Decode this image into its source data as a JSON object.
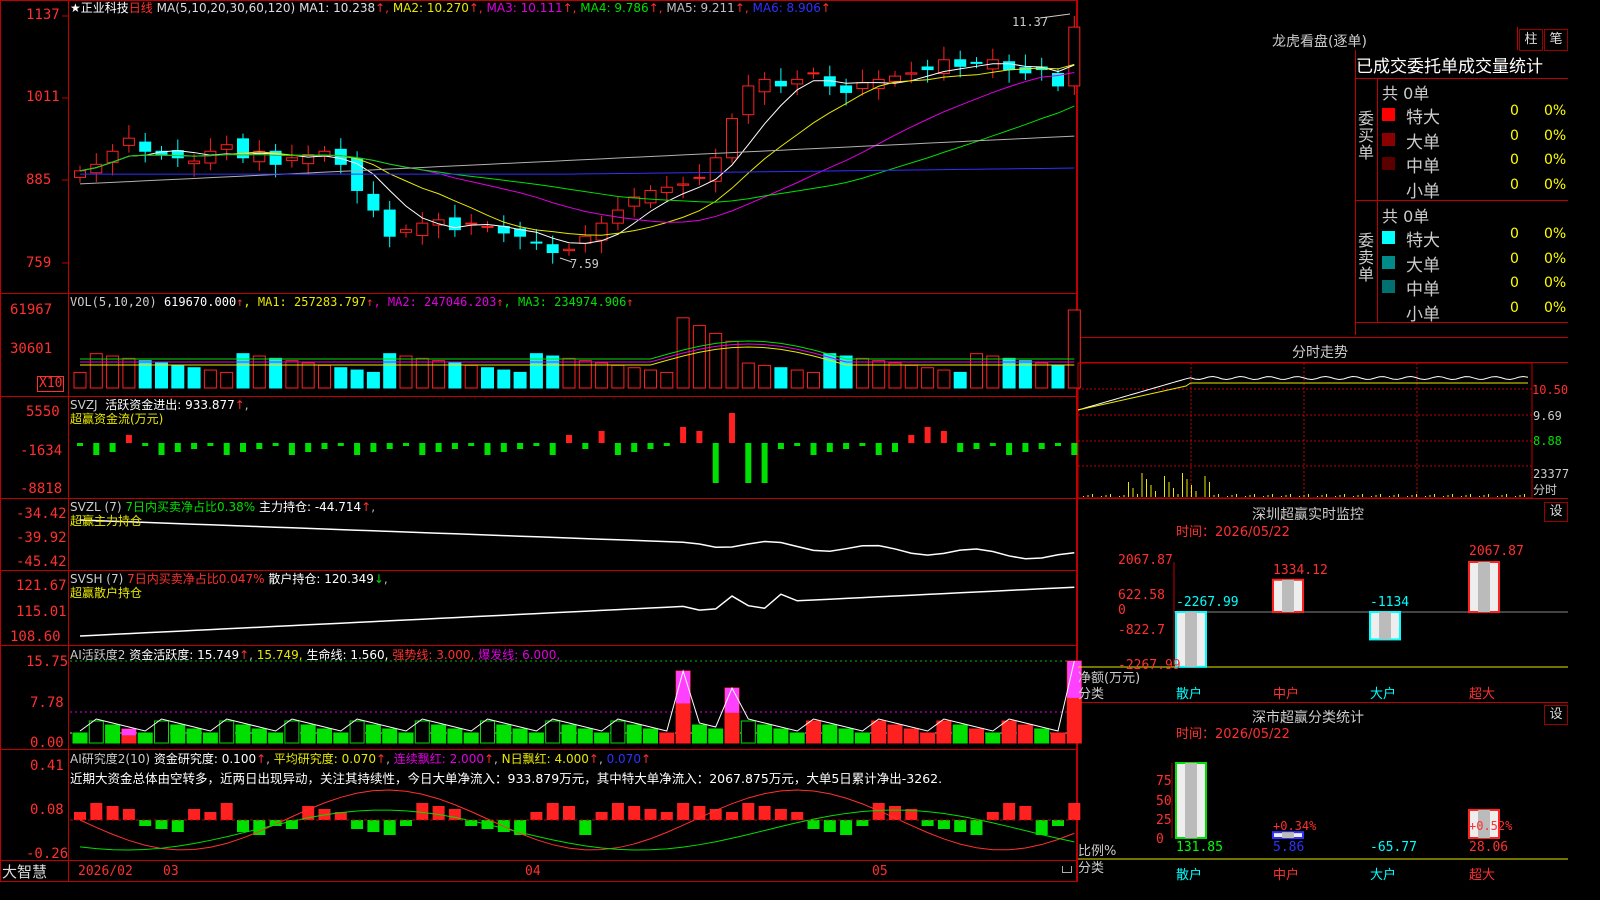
{
  "header": {
    "stock_name": "正业科技",
    "period": "日线",
    "ma_label": "MA(5,10,20,30,60,120)",
    "ma_items": [
      {
        "name": "MA1:",
        "value": "10.238",
        "color": "#e0e0e0"
      },
      {
        "name": "MA2:",
        "value": "10.270",
        "color": "#e8e800"
      },
      {
        "name": "MA3:",
        "value": "10.111",
        "color": "#e000e0"
      },
      {
        "name": "MA4:",
        "value": "9.786",
        "color": "#00e000"
      },
      {
        "name": "MA5:",
        "value": "9.211",
        "color": "#c0c0c0"
      },
      {
        "name": "MA6:",
        "value": "8.906",
        "color": "#3030ff"
      }
    ],
    "arrow": "↑"
  },
  "price_axis": [
    "1137",
    "1011",
    "885",
    "759"
  ],
  "price_marks": {
    "high": "11.37",
    "low": "7.59"
  },
  "vol_panel": {
    "label": "VOL(5,10,20)",
    "value": "619670.000",
    "items": [
      {
        "name": "MA1:",
        "value": "257283.797",
        "color": "#e8e800"
      },
      {
        "name": "MA2:",
        "value": "247046.203",
        "color": "#e000e0"
      },
      {
        "name": "MA3:",
        "value": "234974.906",
        "color": "#00e000"
      }
    ],
    "axis": [
      "61967",
      "30601"
    ],
    "unit": "X10"
  },
  "svzj_panel": {
    "label": "SVZJ",
    "title": "活跃资金进出:",
    "value": "933.877",
    "subtitle": "超赢资金流(万元)",
    "axis": [
      "5550",
      "-1634",
      "-8818"
    ]
  },
  "svzl_panel": {
    "label": "SVZL (7)",
    "ratio": "7日内买卖净占比0.38%",
    "name": "主力持仓:",
    "value": "-44.714",
    "subtitle": "超赢主力持仓",
    "axis": [
      "-34.42",
      "-39.92",
      "-45.42"
    ]
  },
  "svsh_panel": {
    "label": "SVSH (7)",
    "ratio": "7日内买卖净占比0.047%",
    "name": "散户持仓:",
    "value": "120.349",
    "subtitle": "超赢散户持仓",
    "axis": [
      "121.67",
      "115.01",
      "108.60"
    ]
  },
  "ai_active": {
    "label": "AI活跃度2",
    "name": "资金活跃度:",
    "value": "15.749",
    "value2": "15.749,",
    "life": "生命线:",
    "life_v": "1.560,",
    "strong": "强势线:",
    "strong_v": "3.000,",
    "burst": "爆发线:",
    "burst_v": "6.000,",
    "axis": [
      "15.75",
      "7.78",
      "0.00"
    ]
  },
  "ai_research": {
    "label": "AI研究度2(10)",
    "name": "资金研究度:",
    "value": "0.100",
    "avg": "平均研究度:",
    "avg_v": "0.070",
    "cont": "连续飘红:",
    "cont_v": "2.000",
    "nday": "N日飘红:",
    "nday_v": "4.000",
    "last": "0.070",
    "axis": [
      "0.41",
      "0.08",
      "-0.26"
    ],
    "comment": "近期大资金总体由空转多，近两日出现异动，关注其持续性，今日大单净流入：933.879万元，其中特大单净流入：2067.875万元，大单5日累计净出-3262."
  },
  "date_axis": [
    "2026/02",
    "03",
    "04",
    "05"
  ],
  "brand": "大智慧",
  "right": {
    "title": "龙虎看盘(逐单)",
    "btn_bar": "柱",
    "btn_pen": "笔",
    "tabs": [
      "已成交",
      "委托单",
      "成交量统计"
    ],
    "buy_label": "委买单",
    "sell_label": "委卖单",
    "buy_total": "共 0单",
    "sell_total": "共 0单",
    "buy_rows": [
      {
        "name": "特大",
        "n": "0",
        "pct": "0%",
        "color": "#ff0000"
      },
      {
        "name": "大单",
        "n": "0",
        "pct": "0%",
        "color": "#8b0000"
      },
      {
        "name": "中单",
        "n": "0",
        "pct": "0%",
        "color": "#5a0000"
      },
      {
        "name": "小单",
        "n": "0",
        "pct": "0%",
        "color": "#000"
      }
    ],
    "sell_rows": [
      {
        "name": "特大",
        "n": "0",
        "pct": "0%",
        "color": "#00ffff"
      },
      {
        "name": "大单",
        "n": "0",
        "pct": "0%",
        "color": "#008b8b"
      },
      {
        "name": "中单",
        "n": "0",
        "pct": "0%",
        "color": "#007070"
      },
      {
        "name": "小单",
        "n": "0",
        "pct": "0%",
        "color": "#000"
      }
    ],
    "intraday_title": "分时走势",
    "intraday_axis": [
      "10.50",
      "9.69",
      "8.88",
      "23377",
      "分时"
    ],
    "monitor": {
      "title": "深圳超赢实时监控",
      "btn": "设",
      "time": "时间：2026/05/22",
      "axis": [
        "2067.87",
        "622.58",
        "0",
        "-822.7",
        "-2267.99"
      ],
      "ylabel1": "净额(万元)",
      "ylabel2": "分类",
      "chart_data": {
        "type": "bar",
        "categories": [
          "散户",
          "中户",
          "大户",
          "超大"
        ],
        "values": [
          -2267.99,
          1334.12,
          -1134,
          2067.87
        ],
        "labels": [
          "-2267.99",
          "1334.12",
          "-1134",
          "2067.87"
        ],
        "ylim": [
          -2267.99,
          2067.87
        ]
      }
    },
    "classify": {
      "title": "深市超赢分类统计",
      "btn": "设",
      "time": "时间：2026/05/22",
      "axis": [
        "75",
        "50",
        "25",
        "0"
      ],
      "ylabel1": "比例%",
      "ylabel2": "分类",
      "chart_data": {
        "type": "bar",
        "categories": [
          "散户",
          "中户",
          "大户",
          "超大"
        ],
        "values": [
          131.85,
          5.86,
          -65.77,
          28.06
        ],
        "labels": [
          "131.85",
          "5.86",
          "-65.77",
          "28.06"
        ],
        "deltas": [
          "",
          "+0.34%",
          "",
          "+0.52%"
        ]
      }
    }
  }
}
